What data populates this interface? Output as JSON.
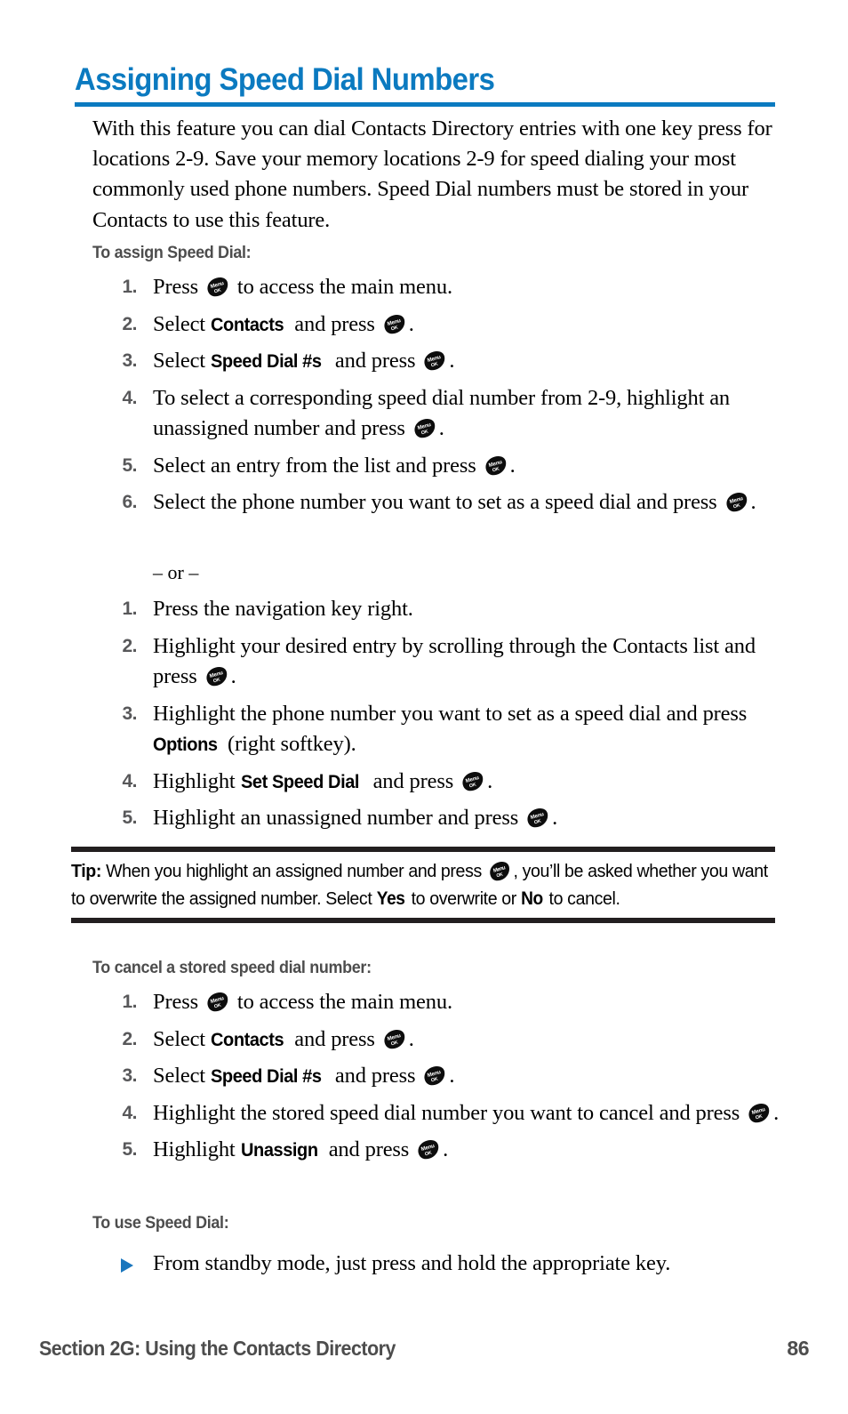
{
  "document": {
    "title": "Assigning Speed Dial Numbers",
    "accent_color": "#0b7ac0",
    "rule_color": "#231f20",
    "subhead_color": "#4d4d4d",
    "number_color": "#58585a",
    "bullet_color": "#1a76bd"
  },
  "intro": {
    "paragraph": "With this feature you can dial Contacts Directory entries with one key press for locations 2-9. Save your memory locations 2-9 for speed dialing your most commonly used phone numbers. Speed Dial numbers must be stored in your Contacts to use this feature."
  },
  "icons": {
    "menu_ok": {
      "name": "menu-ok-key-icon",
      "line1": "Menu",
      "line2": "OK"
    },
    "bullet": {
      "name": "triangle-bullet-icon"
    }
  },
  "sections": [
    {
      "heading": "To assign Speed Dial:",
      "steps": [
        {
          "num": "1",
          "parts": [
            {
              "t": "text",
              "v": "Press "
            },
            {
              "t": "icon",
              "v": "menu-ok"
            },
            {
              "t": "text",
              "v": " to access the main menu."
            }
          ]
        },
        {
          "num": "2",
          "parts": [
            {
              "t": "text",
              "v": "Select "
            },
            {
              "t": "bold",
              "v": "Contacts"
            },
            {
              "t": "text",
              "v": " and press "
            },
            {
              "t": "icon",
              "v": "menu-ok"
            },
            {
              "t": "text",
              "v": "."
            }
          ]
        },
        {
          "num": "3",
          "parts": [
            {
              "t": "text",
              "v": "Select "
            },
            {
              "t": "bold",
              "v": "Speed Dial #s"
            },
            {
              "t": "text",
              "v": " and press "
            },
            {
              "t": "icon",
              "v": "menu-ok"
            },
            {
              "t": "text",
              "v": "."
            }
          ]
        },
        {
          "num": "4",
          "parts": [
            {
              "t": "text",
              "v": "To select a corresponding speed dial number from 2-9, highlight an unassigned number and press "
            },
            {
              "t": "icon",
              "v": "menu-ok"
            },
            {
              "t": "text",
              "v": "."
            }
          ]
        },
        {
          "num": "5",
          "parts": [
            {
              "t": "text",
              "v": "Select an entry from the list and press "
            },
            {
              "t": "icon",
              "v": "menu-ok"
            },
            {
              "t": "text",
              "v": "."
            }
          ]
        },
        {
          "num": "6",
          "parts": [
            {
              "t": "text",
              "v": "Select the phone number you want to set as a speed dial and press "
            },
            {
              "t": "icon",
              "v": "menu-ok"
            },
            {
              "t": "text",
              "v": "."
            }
          ]
        }
      ],
      "separator": "– or –",
      "steps_alt": [
        {
          "num": "1",
          "parts": [
            {
              "t": "text",
              "v": "Press the navigation key right."
            }
          ]
        },
        {
          "num": "2",
          "parts": [
            {
              "t": "text",
              "v": "Highlight your desired entry by scrolling through the Contacts list and press "
            },
            {
              "t": "icon",
              "v": "menu-ok"
            },
            {
              "t": "text",
              "v": "."
            }
          ]
        },
        {
          "num": "3",
          "parts": [
            {
              "t": "text",
              "v": "Highlight the phone number you want to set as a speed dial and press "
            },
            {
              "t": "bold",
              "v": "Options"
            },
            {
              "t": "text",
              "v": " (right softkey)."
            }
          ]
        },
        {
          "num": "4",
          "parts": [
            {
              "t": "text",
              "v": "Highlight "
            },
            {
              "t": "bold",
              "v": "Set Speed Dial"
            },
            {
              "t": "text",
              "v": " and press "
            },
            {
              "t": "icon",
              "v": "menu-ok"
            },
            {
              "t": "text",
              "v": "."
            }
          ]
        },
        {
          "num": "5",
          "parts": [
            {
              "t": "text",
              "v": "Highlight an unassigned number and press "
            },
            {
              "t": "icon",
              "v": "menu-ok"
            },
            {
              "t": "text",
              "v": "."
            }
          ]
        }
      ]
    },
    {
      "heading": "To cancel a stored speed dial number:",
      "steps": [
        {
          "num": "1",
          "parts": [
            {
              "t": "text",
              "v": "Press "
            },
            {
              "t": "icon",
              "v": "menu-ok"
            },
            {
              "t": "text",
              "v": " to access the main menu."
            }
          ]
        },
        {
          "num": "2",
          "parts": [
            {
              "t": "text",
              "v": "Select "
            },
            {
              "t": "bold",
              "v": "Contacts"
            },
            {
              "t": "text",
              "v": " and press "
            },
            {
              "t": "icon",
              "v": "menu-ok"
            },
            {
              "t": "text",
              "v": "."
            }
          ]
        },
        {
          "num": "3",
          "parts": [
            {
              "t": "text",
              "v": "Select "
            },
            {
              "t": "bold",
              "v": "Speed Dial #s"
            },
            {
              "t": "text",
              "v": " and press "
            },
            {
              "t": "icon",
              "v": "menu-ok"
            },
            {
              "t": "text",
              "v": "."
            }
          ]
        },
        {
          "num": "4",
          "parts": [
            {
              "t": "text",
              "v": "Highlight the stored speed dial number you want to cancel and press "
            },
            {
              "t": "icon",
              "v": "menu-ok"
            },
            {
              "t": "text",
              "v": "."
            }
          ]
        },
        {
          "num": "5",
          "parts": [
            {
              "t": "text",
              "v": "Highlight "
            },
            {
              "t": "bold",
              "v": "Unassign"
            },
            {
              "t": "text",
              "v": " and press "
            },
            {
              "t": "icon",
              "v": "menu-ok"
            },
            {
              "t": "text",
              "v": "."
            }
          ]
        }
      ]
    },
    {
      "heading": "To use Speed Dial:",
      "bullets": [
        {
          "parts": [
            {
              "t": "text",
              "v": "From standby mode, just press and hold the appropriate key."
            }
          ]
        }
      ]
    }
  ],
  "tip": {
    "label": "Tip:",
    "parts": [
      {
        "t": "boldlabel",
        "v": "Tip:"
      },
      {
        "t": "text",
        "v": " When you highlight an assigned number and press "
      },
      {
        "t": "icon",
        "v": "menu-ok"
      },
      {
        "t": "text",
        "v": ", you’ll be asked whether you want to overwrite the assigned number. Select "
      },
      {
        "t": "bold",
        "v": "Yes"
      },
      {
        "t": "text",
        "v": " to overwrite or "
      },
      {
        "t": "bold",
        "v": "No"
      },
      {
        "t": "text",
        "v": " to cancel."
      }
    ]
  },
  "footer": {
    "section": "Section 2G: Using the Contacts Directory",
    "page_number": "86"
  }
}
